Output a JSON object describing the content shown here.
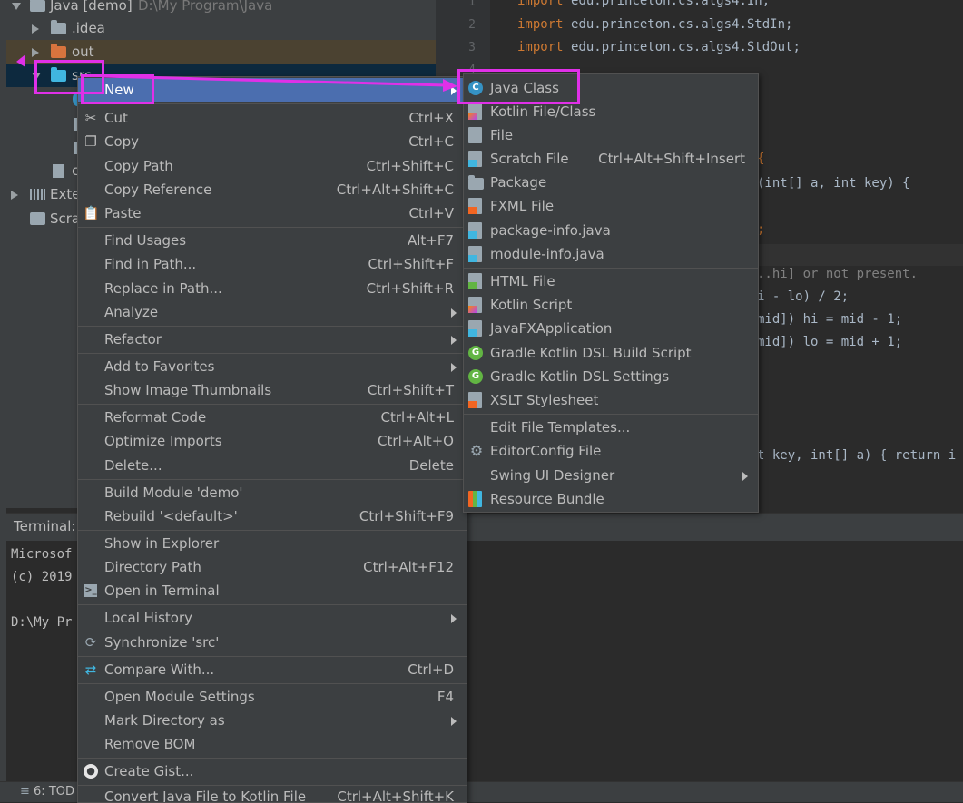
{
  "colors": {
    "annotation": "#e030e8",
    "selection": "#4b6eaf",
    "menu_bg": "#3c3f41",
    "editor_bg": "#2b2b2b"
  },
  "project_tree": {
    "root_label": "Java [demo]",
    "root_path": "D:\\My Program\\Java",
    "idea": ".idea",
    "out": "out",
    "src": "src",
    "external": "Exte",
    "scratches": "Scra",
    "item_c": "c"
  },
  "editor": {
    "line_numbers": [
      "1",
      "2",
      "3",
      "4"
    ],
    "imports": [
      "edu.princeton.cs.algs4.In;",
      "edu.princeton.cs.algs4.StdIn;",
      "edu.princeton.cs.algs4.StdOut;"
    ],
    "frag_method": "(int[] a, int key) {",
    "frag_semicolon": ";",
    "frag_comment": "..hi] or not present.",
    "frag_mid": "i - lo) / 2;",
    "frag_hi": "mid]) hi = mid - 1;",
    "frag_lo": "mid]) lo = mid + 1;",
    "frag_bracket": "{",
    "frag_return": "t key, int[] a) { return i"
  },
  "terminal": {
    "title": "Terminal:",
    "line1": "Microsof",
    "line2": "(c) 2019",
    "line3": "D:\\My Pr"
  },
  "status_bar": {
    "todo": "6: TOD"
  },
  "context_menu": {
    "new": "New",
    "cut": "Cut",
    "cut_sc": "Ctrl+X",
    "copy": "Copy",
    "copy_sc": "Ctrl+C",
    "copy_path": "Copy Path",
    "copy_path_sc": "Ctrl+Shift+C",
    "copy_reference": "Copy Reference",
    "copy_reference_sc": "Ctrl+Alt+Shift+C",
    "paste": "Paste",
    "paste_sc": "Ctrl+V",
    "find_usages": "Find Usages",
    "find_usages_sc": "Alt+F7",
    "find_in_path": "Find in Path...",
    "find_in_path_sc": "Ctrl+Shift+F",
    "replace_in_path": "Replace in Path...",
    "replace_in_path_sc": "Ctrl+Shift+R",
    "analyze": "Analyze",
    "refactor": "Refactor",
    "add_to_favorites": "Add to Favorites",
    "show_image_thumbnails": "Show Image Thumbnails",
    "show_image_thumbnails_sc": "Ctrl+Shift+T",
    "reformat_code": "Reformat Code",
    "reformat_code_sc": "Ctrl+Alt+L",
    "optimize_imports": "Optimize Imports",
    "optimize_imports_sc": "Ctrl+Alt+O",
    "delete": "Delete...",
    "delete_sc": "Delete",
    "build_module": "Build Module 'demo'",
    "rebuild": "Rebuild '<default>'",
    "rebuild_sc": "Ctrl+Shift+F9",
    "show_in_explorer": "Show in Explorer",
    "directory_path": "Directory Path",
    "directory_path_sc": "Ctrl+Alt+F12",
    "open_in_terminal": "Open in Terminal",
    "local_history": "Local History",
    "synchronize": "Synchronize 'src'",
    "compare_with": "Compare With...",
    "compare_with_sc": "Ctrl+D",
    "open_module_settings": "Open Module Settings",
    "open_module_settings_sc": "F4",
    "mark_directory_as": "Mark Directory as",
    "remove_bom": "Remove BOM",
    "create_gist": "Create Gist...",
    "convert_java": "Convert Java File to Kotlin File",
    "convert_java_sc": "Ctrl+Alt+Shift+K"
  },
  "submenu": {
    "java_class": "Java Class",
    "kotlin_file_class": "Kotlin File/Class",
    "file": "File",
    "scratch_file": "Scratch File",
    "scratch_file_sc": "Ctrl+Alt+Shift+Insert",
    "package": "Package",
    "fxml_file": "FXML File",
    "package_info": "package-info.java",
    "module_info": "module-info.java",
    "html_file": "HTML File",
    "kotlin_script": "Kotlin Script",
    "javafx_application": "JavaFXApplication",
    "gradle_kotlin_dsl_build": "Gradle Kotlin DSL Build Script",
    "gradle_kotlin_dsl_settings": "Gradle Kotlin DSL Settings",
    "xslt_stylesheet": "XSLT Stylesheet",
    "edit_file_templates": "Edit File Templates...",
    "editorconfig_file": "EditorConfig File",
    "swing_ui_designer": "Swing UI Designer",
    "resource_bundle": "Resource Bundle"
  }
}
